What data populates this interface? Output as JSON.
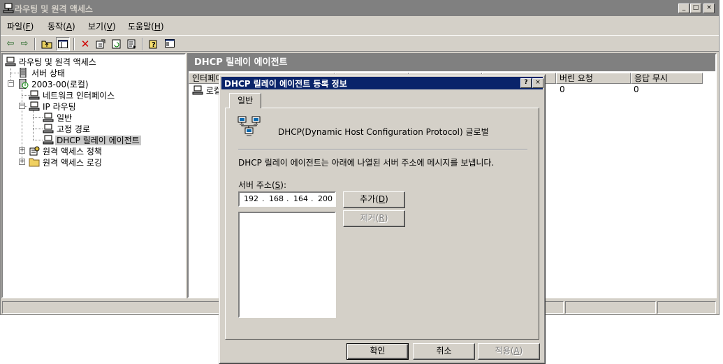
{
  "window": {
    "title": "라우팅 및 원격 액세스",
    "minimize": "_",
    "maximize": "□",
    "close": "×"
  },
  "menu": [
    {
      "label": "파일(",
      "key": "F",
      "end": ")"
    },
    {
      "label": "동작(",
      "key": "A",
      "end": ")"
    },
    {
      "label": "보기(",
      "key": "V",
      "end": ")"
    },
    {
      "label": "도움말(",
      "key": "H",
      "end": ")"
    }
  ],
  "tree": {
    "root": "라우팅 및 원격 액세스",
    "server_status": "서버 상태",
    "server": "2003-00(로컬)",
    "network_interfaces": "네트워크 인터페이스",
    "ip_routing": "IP 라우팅",
    "general": "일반",
    "static_routes": "고정 경로",
    "dhcp_relay": "DHCP 릴레이 에이전트",
    "remote_access_policy": "원격 액세스 정책",
    "remote_access_logging": "원격 액세스 로깅"
  },
  "right_pane": {
    "header": "DHCP 릴레이 에이전트",
    "columns": [
      "인터페이스",
      "",
      "",
      "",
      "버린 요청",
      "응답 무시"
    ],
    "row": {
      "interface": "로컬",
      "dropped_requests": "0",
      "ignored_responses": "0"
    }
  },
  "dialog": {
    "title": "DHCP 릴레이 에이전트 등록 정보",
    "help": "?",
    "close": "×",
    "tab": "일반",
    "heading": "DHCP(Dynamic Host Configuration Protocol) 글로벌",
    "description": "DHCP 릴레이 에이전트는 아래에 나열된 서버 주소에 메시지를 보냅니다.",
    "server_address_label": "서버 주소(",
    "server_address_key": "S",
    "server_address_end": "):",
    "ip": [
      "192",
      "168",
      "164",
      "200"
    ],
    "ip_dot": ".",
    "add_button": {
      "label": "추가(",
      "key": "D",
      "end": ")"
    },
    "remove_button": {
      "label": "제거(",
      "key": "R",
      "end": ")"
    },
    "ok_button": "확인",
    "cancel_button": "취소",
    "apply_button": {
      "label": "적용(",
      "key": "A",
      "end": ")"
    }
  },
  "colors": {
    "face": "#d4d0c8",
    "inactive_title": "#808080",
    "active_title": "#0a246a",
    "selection": "#c8c8c8"
  }
}
